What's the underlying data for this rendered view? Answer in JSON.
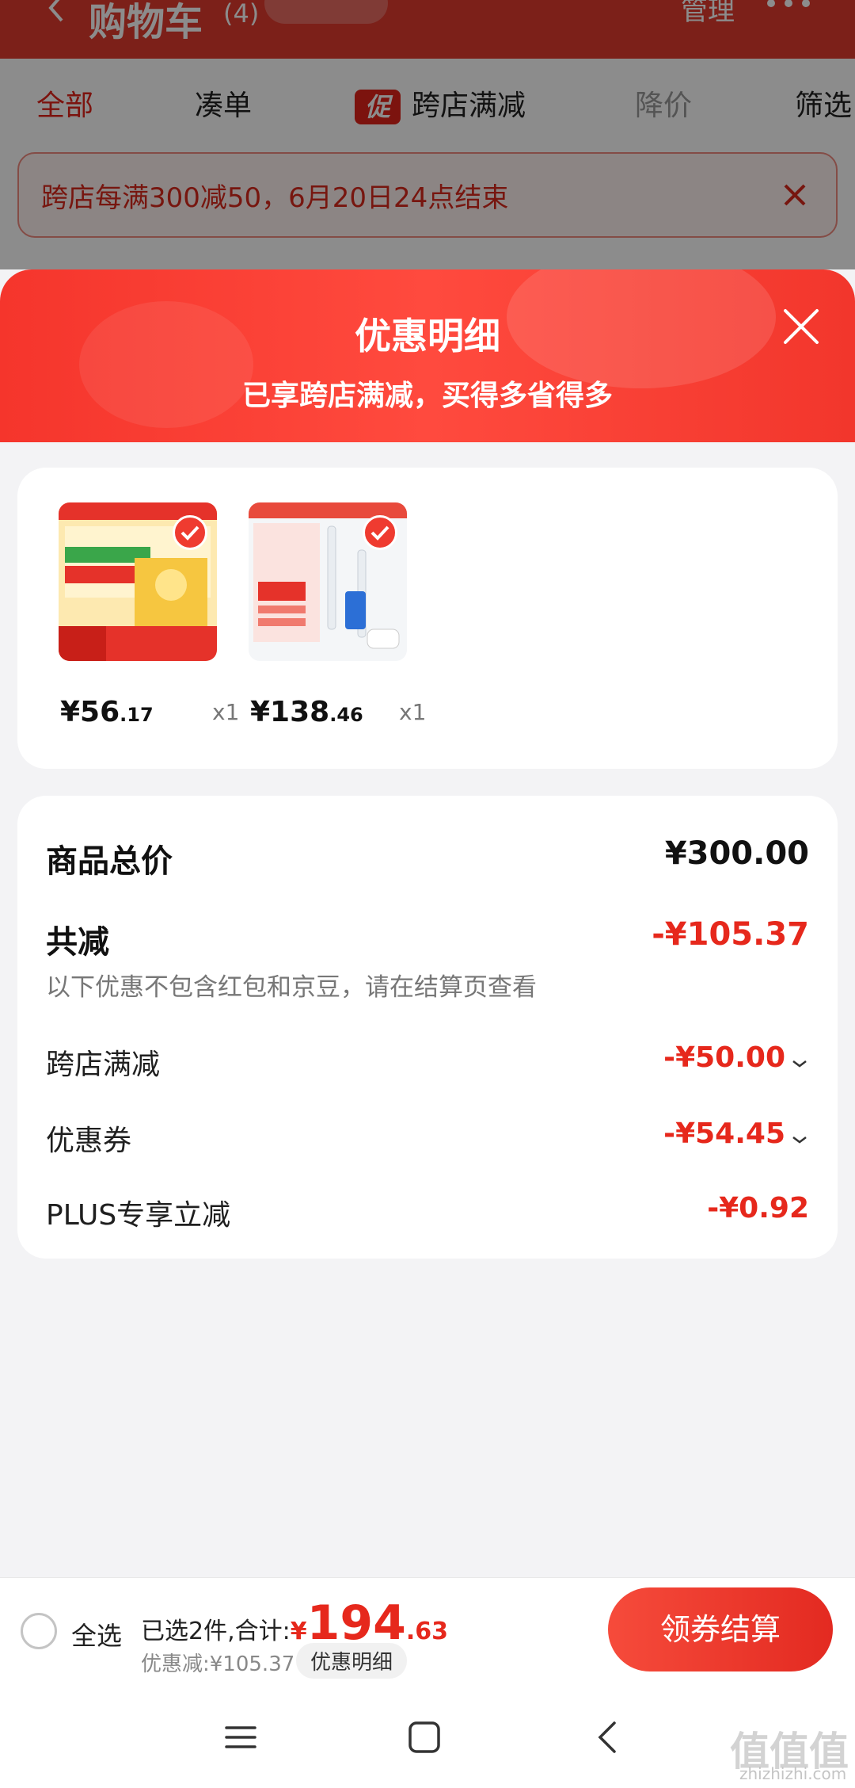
{
  "background": {
    "cart_title": "购物车",
    "cart_count": "(4)",
    "manage_label": "管理",
    "tabs": [
      {
        "label": "全部"
      },
      {
        "label": "凑单"
      },
      {
        "label": "跨店满减"
      },
      {
        "label": "降价"
      },
      {
        "label": "筛选"
      }
    ],
    "promo_chip": "促",
    "promo_banner": "跨店每满300减50，6月20日24点结束"
  },
  "sheet": {
    "title": "优惠明细",
    "subtitle": "已享跨店满减，买得多省得多",
    "products": [
      {
        "price_int": "¥56",
        "price_dec": ".17",
        "qty": "x1"
      },
      {
        "price_int": "¥138",
        "price_dec": ".46",
        "qty": "x1"
      }
    ],
    "summary": {
      "total_label": "商品总价",
      "total_value": "¥300.00",
      "reduce_label": "共减",
      "reduce_value": "-¥105.37",
      "reduce_hint": "以下优惠不包含红包和京豆，请在结算页查看",
      "items": [
        {
          "label": "跨店满减",
          "value": "-¥50.00"
        },
        {
          "label": "优惠券",
          "value": "-¥54.45"
        },
        {
          "label": "PLUS专享立减",
          "value": "-¥0.92"
        }
      ]
    }
  },
  "checkout": {
    "select_all": "全选",
    "selected_text": "已选2件,合计:",
    "total_symbol": "¥",
    "total_int": "194",
    "total_dec": ".63",
    "discount_text": "优惠减:¥105.37",
    "detail_label": "优惠明细",
    "button_label": "领券结算"
  },
  "watermark": {
    "main": "值值值",
    "sub": "zhizhizhi.com"
  },
  "colors": {
    "accent": "#e6281c",
    "header": "#f5352c"
  }
}
